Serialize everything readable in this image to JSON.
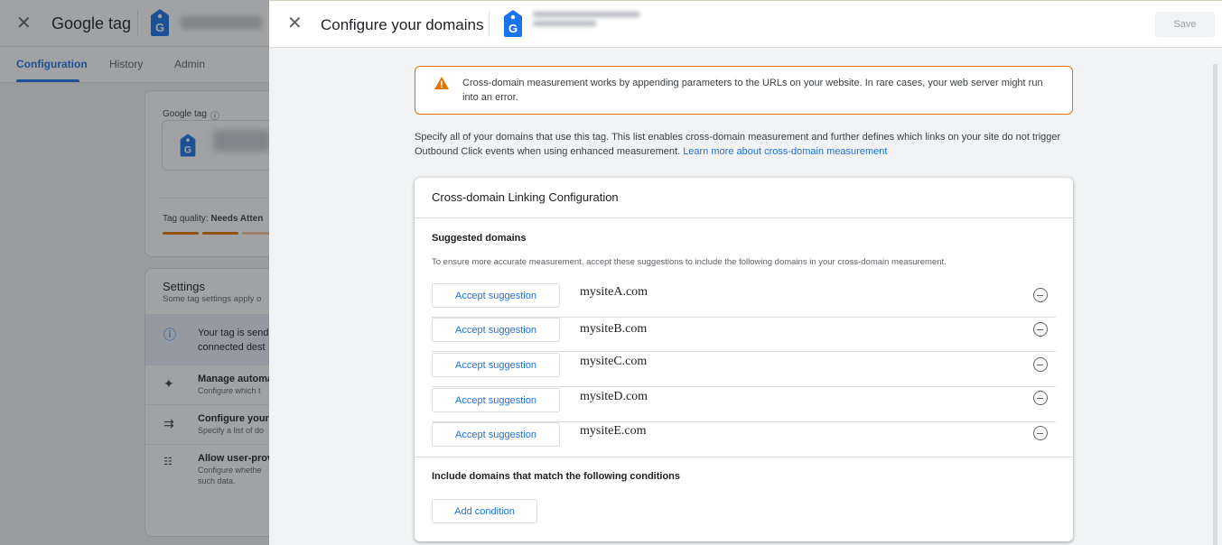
{
  "background": {
    "title": "Google tag",
    "tabs": [
      "Configuration",
      "History",
      "Admin"
    ],
    "tag_label": "Google tag",
    "tag_quality_label": "Tag quality:",
    "tag_quality_value": "Needs Atten",
    "settings_title": "Settings",
    "settings_sub": "Some tag settings apply o",
    "rows": [
      {
        "title": "Your tag is send",
        "sub": "connected dest"
      },
      {
        "title": "Manage automa",
        "sub": "Configure which t"
      },
      {
        "title": "Configure your",
        "sub": "Specify a list of do"
      },
      {
        "title": "Allow user-prov",
        "sub": "Configure whethe",
        "sub2": "such data."
      }
    ]
  },
  "panel": {
    "title": "Configure your domains",
    "save_label": "Save",
    "warning": "Cross-domain measurement works by appending parameters to the URLs on your website. In rare cases, your web server might run into an error.",
    "intro": "Specify all of your domains that use this tag. This list enables cross-domain measurement and further defines which links on your site do not trigger Outbound Click events when using enhanced measurement.",
    "learn_more": "Learn more about cross-domain measurement",
    "card": {
      "title": "Cross-domain Linking Configuration",
      "suggested_title": "Suggested domains",
      "suggested_desc": "To ensure more accurate measurement, accept these suggestions to include the following domains in your cross-domain measurement.",
      "accept_label": "Accept suggestion",
      "domains": [
        "mysiteA.com",
        "mysiteB.com",
        "mysiteC.com",
        "mysiteD.com",
        "mysiteE.com"
      ],
      "conditions_title": "Include domains that match the following conditions",
      "add_condition_label": "Add condition"
    }
  },
  "colors": {
    "accent": "#1a73e8",
    "warning": "#e37400",
    "tag_blue": "#1a73e8"
  }
}
